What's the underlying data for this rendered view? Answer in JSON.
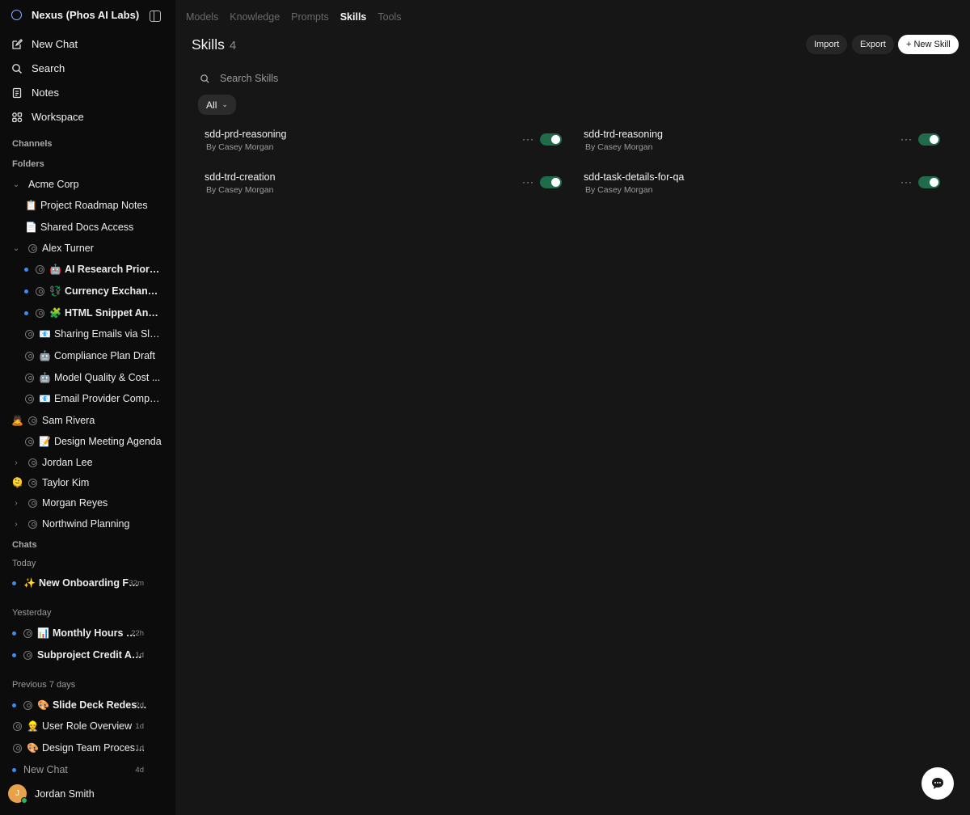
{
  "sidebar": {
    "brand": "Nexus (Phos AI Labs)",
    "nav": [
      {
        "label": "New Chat",
        "icon": "edit-icon"
      },
      {
        "label": "Search",
        "icon": "search-icon"
      },
      {
        "label": "Notes",
        "icon": "notes-icon"
      },
      {
        "label": "Workspace",
        "icon": "workspace-icon"
      }
    ],
    "channels_label": "Channels",
    "folders_label": "Folders",
    "folders": {
      "acme": "Acme Corp",
      "acme_items": [
        {
          "emoji": "📋",
          "label": "Project Roadmap Notes"
        },
        {
          "emoji": "📄",
          "label": "Shared Docs Access"
        }
      ],
      "alex": "Alex Turner",
      "alex_items": [
        {
          "emoji": "🤖",
          "label": "AI Research Prioriti..."
        },
        {
          "emoji": "💱",
          "label": "Currency Exchange..."
        },
        {
          "emoji": "🧩",
          "label": "HTML Snippet Anal..."
        },
        {
          "emoji": "📧",
          "label": "Sharing Emails via Slack"
        },
        {
          "emoji": "🤖",
          "label": "Compliance Plan Draft"
        },
        {
          "emoji": "🤖",
          "label": "Model Quality & Cost ..."
        },
        {
          "emoji": "📧",
          "label": "Email Provider Compa..."
        }
      ],
      "sam": "Sam Rivera",
      "sam_emoji": "🙇",
      "sam_items": [
        {
          "emoji": "📝",
          "label": "Design Meeting Agenda"
        }
      ],
      "jordan": "Jordan Lee",
      "taylor": "Taylor Kim",
      "taylor_emoji": "🫠",
      "morgan": "Morgan Reyes",
      "northwind": "Northwind Planning"
    },
    "chats_label": "Chats",
    "today_label": "Today",
    "yesterday_label": "Yesterday",
    "prev7_label": "Previous 7 days",
    "chats": {
      "today": [
        {
          "emoji": "✨",
          "label": "New Onboarding Flo...",
          "time": "32m"
        }
      ],
      "yesterday": [
        {
          "emoji": "📊",
          "label": "Monthly Hours Br...",
          "time": "22h"
        },
        {
          "emoji": "",
          "label": "Subproject Credit Assi...",
          "time": "1d"
        }
      ],
      "prev7": [
        {
          "emoji": "🎨",
          "label": "Slide Deck Redesign",
          "time": "2d"
        },
        {
          "emoji": "👷",
          "label": "User Role Overview",
          "time": "1d"
        },
        {
          "emoji": "🎨",
          "label": "Design Team Process ...",
          "time": "1d"
        },
        {
          "emoji": "",
          "label": "New Chat",
          "time": "4d"
        }
      ]
    },
    "user": {
      "initial": "J",
      "name": "Jordan Smith"
    }
  },
  "main": {
    "tabs": [
      "Models",
      "Knowledge",
      "Prompts",
      "Skills",
      "Tools"
    ],
    "active_tab": "Skills",
    "title": "Skills",
    "count": "4",
    "buttons": {
      "import": "Import",
      "export": "Export",
      "new_skill": "+ New Skill"
    },
    "search_placeholder": "Search Skills",
    "filter": "All",
    "skills": [
      {
        "name": "sdd-prd-reasoning",
        "author": "By Casey Morgan",
        "enabled": true
      },
      {
        "name": "sdd-trd-reasoning",
        "author": "By Casey Morgan",
        "enabled": true
      },
      {
        "name": "sdd-trd-creation",
        "author": "By Casey Morgan",
        "enabled": true
      },
      {
        "name": "sdd-task-details-for-qa",
        "author": "By Casey Morgan",
        "enabled": true
      }
    ]
  },
  "colors": {
    "accent": "#3b8df0",
    "toggle_on": "#1f6b4a",
    "avatar": "#e8a24a"
  }
}
